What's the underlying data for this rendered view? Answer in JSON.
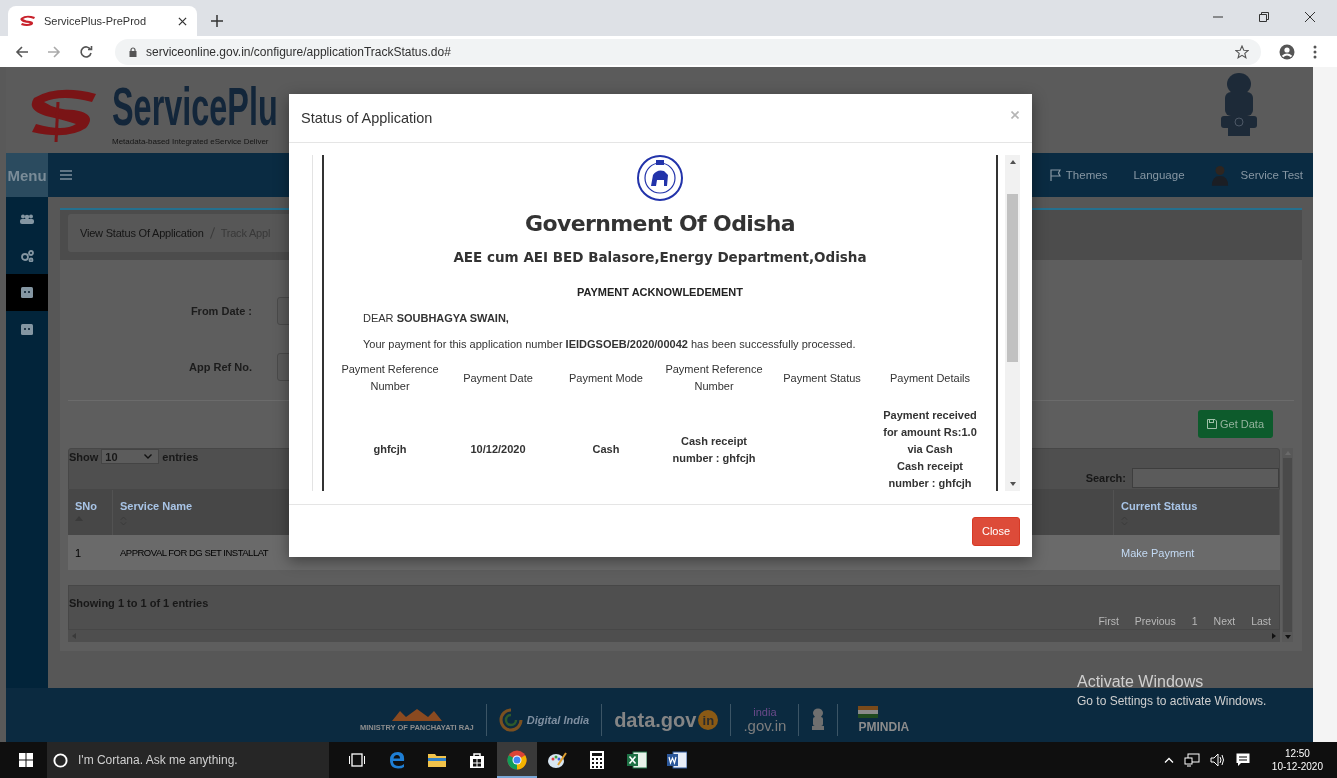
{
  "browser": {
    "tab": {
      "title": "ServicePlus-PreProd"
    },
    "url": "serviceonline.gov.in/configure/applicationTrackStatus.do#"
  },
  "header": {
    "logo_text": "ServicePlu",
    "tagline": "Metadata-based Integrated eService Deliver"
  },
  "navbar": {
    "menu": "Menu",
    "items": [
      {
        "kind": "flag",
        "label": "Themes"
      },
      {
        "kind": "text",
        "label": "Language"
      },
      {
        "kind": "user",
        "label": "Service Test"
      }
    ]
  },
  "sidebar": {
    "items": [
      {
        "kind": "users",
        "selected": false
      },
      {
        "kind": "cogs",
        "selected": false
      },
      {
        "kind": "window",
        "selected": true
      },
      {
        "kind": "window",
        "selected": false
      }
    ]
  },
  "breadcrumb": [
    "View Status Of Application",
    "Track Appl"
  ],
  "form": {
    "fields": [
      {
        "label": "From Date :"
      },
      {
        "label": "App Ref No."
      }
    ]
  },
  "get_data_button": "Get Data",
  "table": {
    "show_label": "Show",
    "page_size": "10",
    "entries_label": "entries",
    "search_label": "Search:",
    "columns": [
      {
        "label": "SNo",
        "sorted": true
      },
      {
        "label": "Service Name",
        "sorted": false
      },
      {
        "label": "Current Status",
        "sorted": false
      }
    ],
    "rows": [
      [
        "1",
        "APPROVAL FOR DG SET INSTALLAT",
        "Make Payment"
      ]
    ],
    "info": "Showing 1 to 1 of 1 entries",
    "pagination": [
      "First",
      "Previous",
      "1",
      "Next",
      "Last"
    ]
  },
  "footer": {
    "logos": [
      {
        "kind": "ministry",
        "text": "MINISTRY OF PANCHAYATI RAJ"
      },
      {
        "kind": "digital-india",
        "text": "Digital India"
      },
      {
        "kind": "datagov",
        "text": "data.gov",
        "badge": "in"
      },
      {
        "kind": "indiagov",
        "top": "india",
        "text": ".gov.in"
      },
      {
        "kind": "emblem"
      },
      {
        "kind": "pmindia",
        "text": "PMINDIA"
      }
    ]
  },
  "modal": {
    "title": "Status of Application",
    "document": {
      "title": "Government Of Odisha",
      "office": "AEE cum AEI BED Balasore,Energy Department,Odisha",
      "heading": "PAYMENT ACKNOWLEDEMENT",
      "greeting": "DEAR **SOUBHAGYA SWAIN,**",
      "message": "Your payment for this application number **IEIDGSOEB/2020/00042** has been successfully processed.",
      "columns": [
        "Payment Reference Number",
        "Payment Date",
        "Payment Mode",
        "Payment Reference Number",
        "Payment Status",
        "Payment Details"
      ],
      "rows": [
        [
          [
            "ghfcjh"
          ],
          [
            "10/12/2020"
          ],
          [
            "Cash"
          ],
          [
            "Cash receipt number : ghfcjh"
          ],
          null,
          [
            "Payment received for amount Rs:1.0 via Cash",
            "Cash receipt number : ghfcjh"
          ]
        ]
      ]
    },
    "close_button": "Close"
  },
  "activation": {
    "title": "Activate Windows",
    "hint": "Go to Settings to activate Windows."
  },
  "taskbar": {
    "search": "I'm Cortana. Ask me anything.",
    "apps": [
      {
        "kind": "taskview",
        "selected": false
      },
      {
        "kind": "edge",
        "selected": false
      },
      {
        "kind": "explorer",
        "selected": false
      },
      {
        "kind": "store",
        "selected": false
      },
      {
        "kind": "chrome",
        "selected": true
      },
      {
        "kind": "paint",
        "selected": false
      },
      {
        "kind": "calculator",
        "selected": false
      },
      {
        "kind": "excel",
        "selected": false
      },
      {
        "kind": "word",
        "selected": false
      }
    ],
    "time": "12:50",
    "date": "10-12-2020"
  }
}
